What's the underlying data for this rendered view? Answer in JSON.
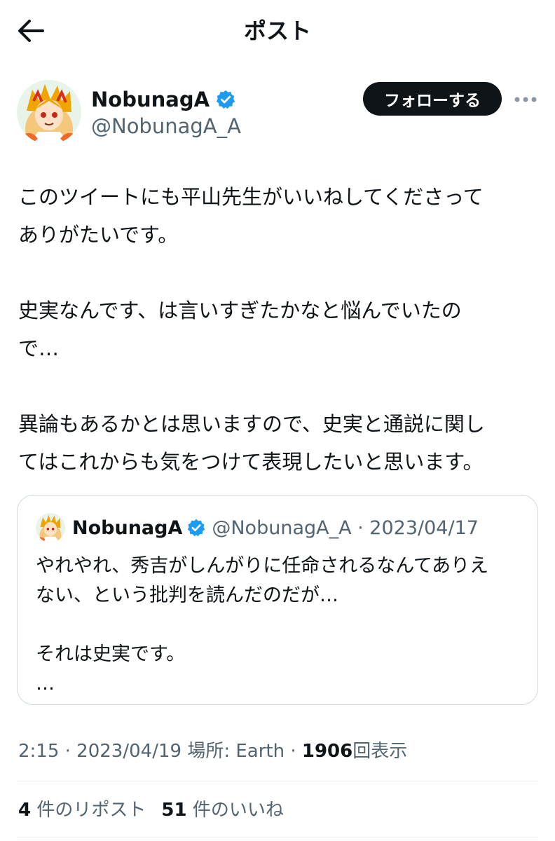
{
  "header": {
    "title": "ポスト",
    "back_icon": "arrow-left-icon"
  },
  "author": {
    "display_name": "NobunagA",
    "handle": "@NobunagA_A",
    "verified": true,
    "follow_label": "フォローする",
    "more_icon": "more-horizontal-icon"
  },
  "tweet": {
    "paragraphs": [
      "このツイートにも平山先生がいいねしてくださって\nありがたいです。",
      "史実なんです、は言いすぎたかなと悩んでいたの\nで…",
      "異論もあるかとは思いますので、史実と通説に関し\nてはこれからも気をつけて表現したいと思います。"
    ]
  },
  "quote": {
    "display_name": "NobunagA",
    "meta": "@NobunagA_A · 2023/04/17",
    "text": "やれやれ、秀吉がしんがりに任命されるなんてありえ\nない、という批判を読んだのだが…\n\nそれは史実です。\n…"
  },
  "meta": {
    "time_date": "2:15 · 2023/04/19",
    "location": "場所: Earth ·",
    "views_count": "1906",
    "views_label": "回表示"
  },
  "stats": {
    "reposts_count": "4",
    "reposts_label": "件のリポスト",
    "likes_count": "51",
    "likes_label": "件のいいね"
  },
  "colors": {
    "text": "#0f1419",
    "secondary": "#536471",
    "verified": "#1d9bf0",
    "border": "#cfd9de"
  }
}
